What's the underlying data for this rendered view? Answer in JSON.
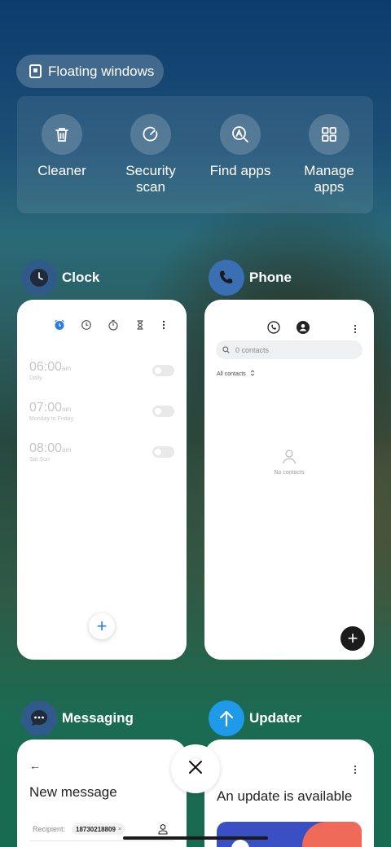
{
  "floating_windows": {
    "label": "Floating windows",
    "icon": "floating-window-icon"
  },
  "tools": [
    {
      "label": "Cleaner",
      "icon": "trash-icon"
    },
    {
      "label": "Security\nscan",
      "icon": "security-scan-icon"
    },
    {
      "label": "Find apps",
      "icon": "find-apps-icon"
    },
    {
      "label": "Manage\napps",
      "icon": "grid-icon"
    }
  ],
  "apps": {
    "clock": {
      "name": "Clock",
      "accent": "#2a7de1",
      "alarms": [
        {
          "time": "06:00",
          "ampm": "am",
          "repeat": "Daily"
        },
        {
          "time": "07:00",
          "ampm": "am",
          "repeat": "Monday to Friday"
        },
        {
          "time": "08:00",
          "ampm": "am",
          "repeat": "Sat Sun"
        }
      ],
      "add_label": "+"
    },
    "phone": {
      "name": "Phone",
      "search_placeholder": "0 contacts",
      "filter_label": "All contacts",
      "empty_label": "No contacts",
      "add_label": "+"
    },
    "messaging": {
      "name": "Messaging",
      "title": "New message",
      "recipient_label": "Recipient:",
      "recipient_chip": "18730218809",
      "chip_close": "×",
      "back_arrow": "←"
    },
    "updater": {
      "name": "Updater",
      "title": "An update is available"
    }
  },
  "close_button": {
    "icon": "close-icon"
  }
}
